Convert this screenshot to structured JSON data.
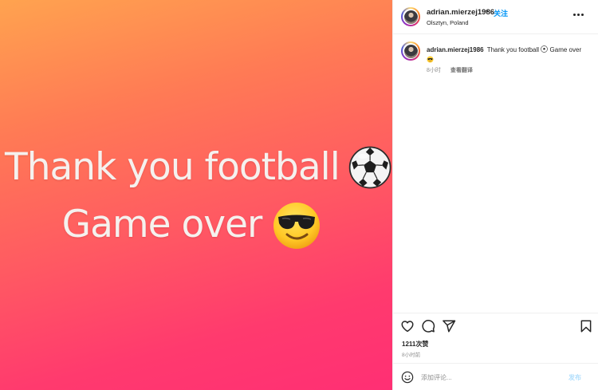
{
  "media": {
    "line1": "Thank you football",
    "line2": "Game over",
    "line1_emoji": "soccer-ball-emoji",
    "line2_emoji": "sunglasses-face-emoji",
    "gradient_colors": [
      "#ffa34f",
      "#ff5a62",
      "#ff2f74"
    ]
  },
  "header": {
    "username": "adrian.mierzej1986",
    "separator": "•",
    "follow_label": "关注",
    "location": "Olsztyn, Poland",
    "more_icon": "more-horizontal-icon"
  },
  "caption": {
    "username": "adrian.mierzej1986",
    "text_part1": "Thank you football",
    "text_part2": "Game over",
    "time": "8小时",
    "translate_label": "查看翻译"
  },
  "actions": {
    "like_icon": "heart-icon",
    "comment_icon": "comment-icon",
    "share_icon": "paper-plane-icon",
    "save_icon": "bookmark-icon",
    "likes_text": "1211次赞",
    "posted_time": "8小时前"
  },
  "comment_box": {
    "emoji_icon": "smiley-icon",
    "placeholder": "添加评论...",
    "post_label": "发布"
  },
  "colors": {
    "accent": "#0095f6",
    "text": "#262626",
    "muted": "#8e8e8e",
    "post_disabled": "#b2dffc"
  }
}
